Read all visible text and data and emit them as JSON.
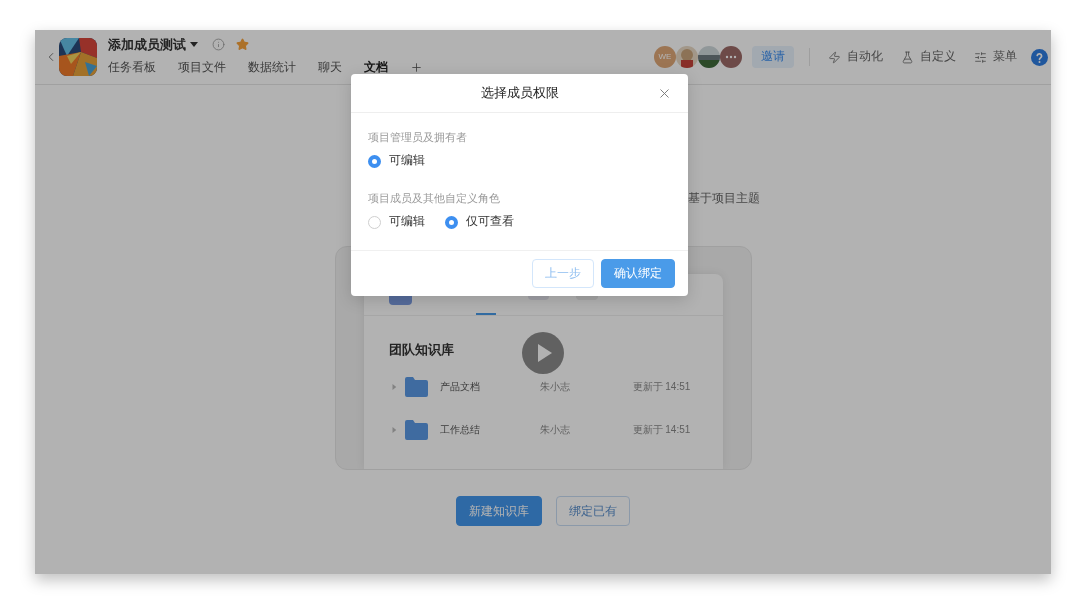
{
  "header": {
    "title": "添加成员测试",
    "starred": true,
    "tabs": [
      {
        "label": "任务看板",
        "selected": false
      },
      {
        "label": "项目文件",
        "selected": false
      },
      {
        "label": "数据统计",
        "selected": false
      },
      {
        "label": "聊天",
        "selected": false
      },
      {
        "label": "文档",
        "selected": true
      }
    ],
    "members": [
      {
        "kind": "initials",
        "text": "WE"
      },
      {
        "kind": "picture"
      },
      {
        "kind": "picture"
      },
      {
        "kind": "more"
      }
    ],
    "invite_button": "邀请",
    "actions": [
      {
        "kind": "automation",
        "label": "自动化"
      },
      {
        "kind": "customize",
        "label": "自定义"
      },
      {
        "kind": "menu",
        "label": "菜单"
      }
    ]
  },
  "background": {
    "hint_fragment": "基于项目主题",
    "preview": {
      "library_title": "团队知识库",
      "rows": [
        {
          "name": "产品文档",
          "owner": "朱小志",
          "updated": "更新于 14:51"
        },
        {
          "name": "工作总结",
          "owner": "朱小志",
          "updated": "更新于 14:51"
        }
      ]
    },
    "buttons": [
      {
        "kind": "primary",
        "label": "新建知识库"
      },
      {
        "kind": "secondary",
        "label": "绑定已有"
      }
    ]
  },
  "dialog": {
    "title": "选择成员权限",
    "groups": [
      {
        "label": "项目管理员及拥有者",
        "options": [
          {
            "label": "可编辑",
            "selected": true
          }
        ]
      },
      {
        "label": "项目成员及其他自定义角色",
        "options": [
          {
            "label": "可编辑",
            "selected": false
          },
          {
            "label": "仅可查看",
            "selected": true
          }
        ]
      }
    ],
    "buttons": [
      {
        "kind": "secondary",
        "label": "上一步"
      },
      {
        "kind": "primary",
        "label": "确认绑定"
      }
    ]
  }
}
